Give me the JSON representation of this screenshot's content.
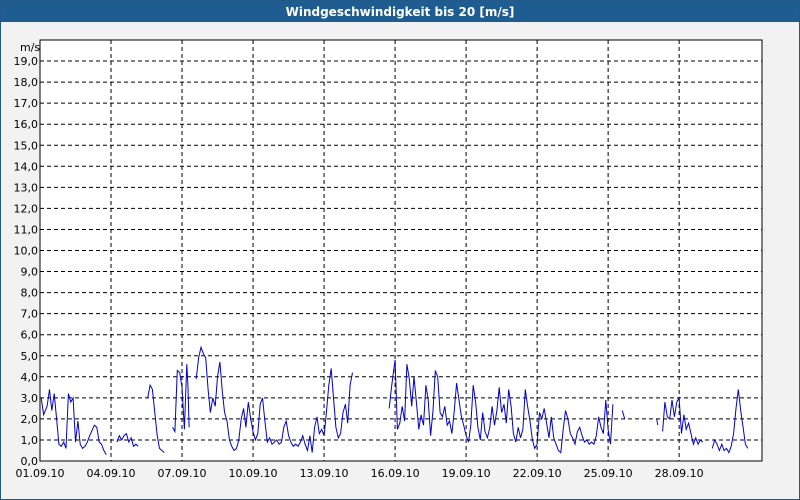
{
  "window": {
    "title": "Windgeschwindigkeit bis 20 [m/s]"
  },
  "colors": {
    "title_bar": "#1f5d91",
    "series": "#0000cc",
    "grid": "#000000",
    "background": "#f2f2f2"
  },
  "chart_data": {
    "type": "line",
    "title": "Windgeschwindigkeit bis 20 [m/s]",
    "ylabel": "m/s",
    "xlabel": "",
    "ylim": [
      0,
      20
    ],
    "xlim_days": [
      0,
      30.5
    ],
    "y_ticks": [
      "0,0",
      "1,0",
      "2,0",
      "3,0",
      "4,0",
      "5,0",
      "6,0",
      "7,0",
      "8,0",
      "9,0",
      "10,0",
      "11,0",
      "12,0",
      "13,0",
      "14,0",
      "15,0",
      "16,0",
      "17,0",
      "18,0",
      "19,0"
    ],
    "x_ticks": [
      {
        "label": "01.09.10",
        "day": 0
      },
      {
        "label": "04.09.10",
        "day": 3
      },
      {
        "label": "07.09.10",
        "day": 6
      },
      {
        "label": "10.09.10",
        "day": 9
      },
      {
        "label": "13.09.10",
        "day": 12
      },
      {
        "label": "16.09.10",
        "day": 15
      },
      {
        "label": "19.09.10",
        "day": 18
      },
      {
        "label": "22.09.10",
        "day": 21
      },
      {
        "label": "25.09.10",
        "day": 24
      },
      {
        "label": "28.09.10",
        "day": 27
      }
    ],
    "grid": true,
    "series": [
      {
        "segments": [
          [
            [
              0.05,
              3.0
            ],
            [
              0.15,
              2.2
            ],
            [
              0.3,
              2.6
            ],
            [
              0.4,
              3.4
            ],
            [
              0.5,
              2.4
            ],
            [
              0.6,
              3.2
            ],
            [
              0.7,
              2.0
            ],
            [
              0.8,
              0.8
            ],
            [
              0.9,
              0.7
            ],
            [
              1.0,
              0.9
            ],
            [
              1.1,
              0.6
            ],
            [
              1.2,
              3.2
            ],
            [
              1.3,
              2.8
            ],
            [
              1.4,
              3.0
            ],
            [
              1.5,
              0.9
            ],
            [
              1.6,
              1.9
            ],
            [
              1.7,
              0.8
            ],
            [
              1.8,
              0.6
            ],
            [
              1.9,
              0.7
            ],
            [
              2.0,
              0.9
            ],
            [
              2.1,
              1.2
            ],
            [
              2.3,
              1.7
            ],
            [
              2.4,
              1.6
            ],
            [
              2.5,
              0.9
            ],
            [
              2.6,
              0.8
            ],
            [
              2.7,
              0.5
            ],
            [
              2.8,
              0.3
            ]
          ],
          [
            [
              3.25,
              0.9
            ],
            [
              3.35,
              1.2
            ],
            [
              3.45,
              1.0
            ],
            [
              3.55,
              1.2
            ],
            [
              3.65,
              1.3
            ],
            [
              3.75,
              0.9
            ],
            [
              3.85,
              1.1
            ],
            [
              3.95,
              0.7
            ],
            [
              4.05,
              0.8
            ],
            [
              4.15,
              0.7
            ]
          ],
          [
            [
              4.55,
              3.0
            ],
            [
              4.65,
              3.6
            ],
            [
              4.75,
              3.4
            ],
            [
              4.85,
              2.3
            ],
            [
              4.95,
              1.2
            ],
            [
              5.05,
              0.6
            ],
            [
              5.15,
              0.5
            ],
            [
              5.25,
              0.4
            ]
          ],
          [
            [
              5.6,
              1.6
            ],
            [
              5.7,
              1.4
            ],
            [
              5.8,
              4.3
            ],
            [
              5.9,
              4.2
            ],
            [
              6.0,
              3.5
            ],
            [
              6.1,
              1.5
            ],
            [
              6.2,
              4.6
            ],
            [
              6.25,
              3.5
            ],
            [
              6.3,
              1.6
            ]
          ],
          [
            [
              6.6,
              3.9
            ],
            [
              6.7,
              4.9
            ],
            [
              6.8,
              5.4
            ],
            [
              6.9,
              5.1
            ],
            [
              7.0,
              4.9
            ],
            [
              7.1,
              3.4
            ],
            [
              7.2,
              2.3
            ],
            [
              7.3,
              3.0
            ],
            [
              7.4,
              2.6
            ],
            [
              7.5,
              4.0
            ],
            [
              7.6,
              4.7
            ],
            [
              7.7,
              3.3
            ],
            [
              7.8,
              2.3
            ],
            [
              7.9,
              1.9
            ],
            [
              8.0,
              1.0
            ],
            [
              8.1,
              0.7
            ],
            [
              8.2,
              0.5
            ],
            [
              8.3,
              0.6
            ],
            [
              8.4,
              1.0
            ],
            [
              8.5,
              2.0
            ],
            [
              8.6,
              2.5
            ],
            [
              8.7,
              1.6
            ],
            [
              8.8,
              2.8
            ],
            [
              8.9,
              2.0
            ],
            [
              9.0,
              1.4
            ],
            [
              9.1,
              1.0
            ],
            [
              9.2,
              1.3
            ],
            [
              9.3,
              2.7
            ],
            [
              9.4,
              3.0
            ],
            [
              9.5,
              1.9
            ],
            [
              9.6,
              0.9
            ],
            [
              9.7,
              1.1
            ],
            [
              9.8,
              0.8
            ],
            [
              9.9,
              0.9
            ],
            [
              10.0,
              1.0
            ],
            [
              10.1,
              0.8
            ],
            [
              10.2,
              0.9
            ],
            [
              10.3,
              1.6
            ],
            [
              10.4,
              1.9
            ],
            [
              10.5,
              1.2
            ],
            [
              10.6,
              0.9
            ],
            [
              10.7,
              0.7
            ],
            [
              10.8,
              0.8
            ],
            [
              10.9,
              0.7
            ],
            [
              11.0,
              0.9
            ],
            [
              11.1,
              1.2
            ],
            [
              11.2,
              0.8
            ],
            [
              11.3,
              0.5
            ],
            [
              11.4,
              1.2
            ],
            [
              11.5,
              0.4
            ],
            [
              11.6,
              1.6
            ],
            [
              11.7,
              2.1
            ],
            [
              11.8,
              1.3
            ],
            [
              11.9,
              1.5
            ],
            [
              12.0,
              1.2
            ],
            [
              12.1,
              2.3
            ],
            [
              12.2,
              3.6
            ],
            [
              12.3,
              4.4
            ],
            [
              12.4,
              3.0
            ],
            [
              12.5,
              1.6
            ],
            [
              12.6,
              1.1
            ],
            [
              12.7,
              1.3
            ],
            [
              12.8,
              2.3
            ],
            [
              12.9,
              2.7
            ],
            [
              13.0,
              1.8
            ],
            [
              13.1,
              3.6
            ],
            [
              13.2,
              4.2
            ]
          ],
          [
            [
              14.75,
              2.5
            ],
            [
              14.85,
              3.5
            ],
            [
              14.95,
              4.4
            ],
            [
              15.0,
              4.8
            ],
            [
              15.1,
              1.5
            ],
            [
              15.2,
              1.8
            ],
            [
              15.3,
              2.6
            ],
            [
              15.4,
              1.9
            ],
            [
              15.5,
              4.6
            ],
            [
              15.6,
              3.9
            ],
            [
              15.7,
              2.6
            ],
            [
              15.8,
              4.0
            ],
            [
              15.9,
              2.8
            ],
            [
              16.0,
              1.5
            ],
            [
              16.1,
              2.2
            ],
            [
              16.2,
              1.7
            ],
            [
              16.3,
              3.6
            ],
            [
              16.4,
              2.9
            ],
            [
              16.5,
              1.2
            ],
            [
              16.6,
              2.4
            ],
            [
              16.7,
              4.3
            ],
            [
              16.8,
              4.0
            ],
            [
              16.9,
              2.3
            ],
            [
              17.0,
              2.1
            ],
            [
              17.1,
              2.6
            ],
            [
              17.2,
              1.7
            ],
            [
              17.3,
              1.9
            ],
            [
              17.4,
              1.3
            ],
            [
              17.5,
              2.4
            ],
            [
              17.6,
              3.7
            ],
            [
              17.7,
              2.9
            ],
            [
              17.8,
              2.1
            ],
            [
              17.9,
              1.7
            ],
            [
              18.0,
              1.2
            ],
            [
              18.1,
              0.9
            ],
            [
              18.2,
              1.7
            ],
            [
              18.3,
              3.6
            ],
            [
              18.4,
              2.8
            ],
            [
              18.5,
              1.6
            ],
            [
              18.6,
              1.0
            ],
            [
              18.7,
              2.3
            ],
            [
              18.8,
              1.4
            ],
            [
              18.9,
              1.1
            ],
            [
              19.0,
              1.6
            ],
            [
              19.1,
              2.6
            ],
            [
              19.2,
              1.7
            ],
            [
              19.3,
              2.4
            ],
            [
              19.4,
              3.5
            ],
            [
              19.5,
              2.3
            ],
            [
              19.6,
              2.7
            ],
            [
              19.7,
              1.8
            ],
            [
              19.8,
              3.4
            ],
            [
              19.9,
              2.6
            ],
            [
              20.0,
              1.3
            ],
            [
              20.1,
              0.9
            ],
            [
              20.2,
              1.6
            ],
            [
              20.3,
              1.1
            ],
            [
              20.4,
              1.5
            ],
            [
              20.5,
              3.4
            ],
            [
              20.6,
              2.6
            ],
            [
              20.7,
              1.9
            ],
            [
              20.8,
              1.0
            ],
            [
              20.9,
              0.6
            ],
            [
              21.0,
              0.8
            ],
            [
              21.1,
              2.3
            ],
            [
              21.2,
              2.0
            ],
            [
              21.3,
              2.5
            ],
            [
              21.4,
              1.8
            ],
            [
              21.5,
              1.1
            ],
            [
              21.6,
              2.1
            ],
            [
              21.7,
              1.1
            ],
            [
              21.8,
              0.8
            ],
            [
              21.9,
              0.5
            ],
            [
              22.0,
              0.4
            ],
            [
              22.1,
              1.5
            ],
            [
              22.2,
              2.4
            ],
            [
              22.3,
              2.0
            ],
            [
              22.4,
              1.3
            ],
            [
              22.5,
              1.1
            ],
            [
              22.6,
              0.8
            ],
            [
              22.7,
              1.4
            ],
            [
              22.8,
              1.6
            ],
            [
              22.9,
              1.2
            ],
            [
              23.0,
              0.9
            ],
            [
              23.1,
              1.0
            ],
            [
              23.2,
              0.8
            ],
            [
              23.3,
              0.9
            ],
            [
              23.4,
              0.8
            ],
            [
              23.5,
              1.2
            ],
            [
              23.6,
              2.1
            ],
            [
              23.7,
              1.6
            ],
            [
              23.8,
              1.3
            ],
            [
              23.9,
              2.9
            ],
            [
              24.0,
              1.5
            ],
            [
              24.1,
              0.8
            ],
            [
              24.2,
              2.7
            ]
          ],
          [
            [
              24.6,
              2.4
            ],
            [
              24.7,
              2.0
            ]
          ],
          [
            [
              26.05,
              2.0
            ],
            [
              26.1,
              1.7
            ]
          ],
          [
            [
              26.3,
              1.4
            ],
            [
              26.4,
              2.8
            ],
            [
              26.5,
              2.1
            ],
            [
              26.6,
              2.0
            ],
            [
              26.7,
              2.9
            ],
            [
              26.8,
              2.1
            ],
            [
              26.9,
              2.8
            ],
            [
              27.0,
              3.0
            ],
            [
              27.1,
              1.3
            ],
            [
              27.2,
              2.2
            ],
            [
              27.3,
              1.5
            ],
            [
              27.4,
              1.8
            ],
            [
              27.5,
              1.3
            ],
            [
              27.6,
              0.8
            ],
            [
              27.7,
              1.1
            ],
            [
              27.8,
              0.8
            ],
            [
              27.9,
              1.0
            ],
            [
              28.0,
              0.9
            ]
          ],
          [
            [
              28.4,
              0.6
            ],
            [
              28.5,
              1.0
            ],
            [
              28.6,
              0.8
            ],
            [
              28.7,
              0.5
            ],
            [
              28.8,
              0.8
            ],
            [
              28.9,
              0.5
            ],
            [
              29.0,
              0.6
            ],
            [
              29.1,
              0.4
            ],
            [
              29.2,
              0.7
            ],
            [
              29.3,
              1.3
            ],
            [
              29.4,
              2.5
            ],
            [
              29.5,
              3.4
            ],
            [
              29.6,
              2.4
            ],
            [
              29.7,
              1.6
            ],
            [
              29.8,
              0.8
            ],
            [
              29.9,
              0.6
            ]
          ]
        ]
      }
    ]
  }
}
